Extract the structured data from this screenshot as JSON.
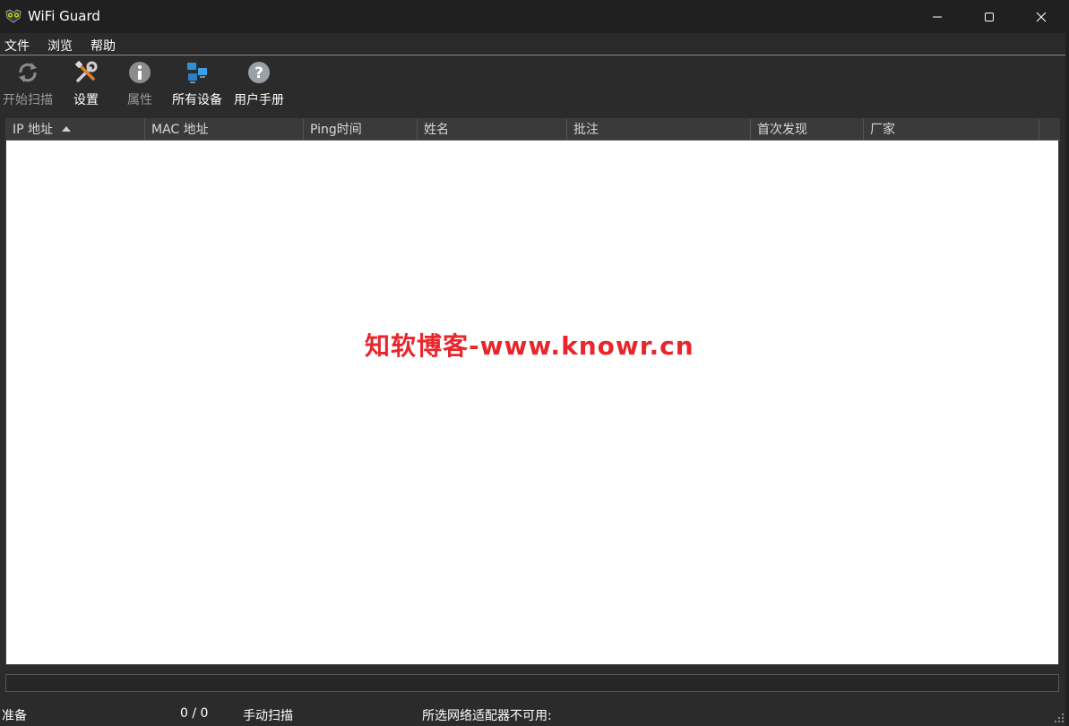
{
  "window": {
    "title": "WiFi Guard"
  },
  "menu": {
    "items": [
      {
        "label": "文件"
      },
      {
        "label": "浏览"
      },
      {
        "label": "帮助"
      }
    ]
  },
  "toolbar": {
    "items": [
      {
        "label": "开始扫描",
        "icon": "refresh-icon",
        "enabled": false
      },
      {
        "label": "设置",
        "icon": "tools-icon",
        "enabled": true
      },
      {
        "label": "属性",
        "icon": "info-icon",
        "enabled": false
      },
      {
        "label": "所有设备",
        "icon": "network-devices-icon",
        "enabled": true
      },
      {
        "label": "用户手册",
        "icon": "help-icon",
        "enabled": true
      }
    ]
  },
  "table": {
    "columns": [
      {
        "label": "IP 地址",
        "sorted": "ascending"
      },
      {
        "label": "MAC 地址"
      },
      {
        "label": "Ping时间"
      },
      {
        "label": "姓名"
      },
      {
        "label": "批注"
      },
      {
        "label": "首次发现"
      },
      {
        "label": "厂家"
      }
    ],
    "rows": []
  },
  "watermark": "知软博客-www.knowr.cn",
  "progress": {
    "value": 0
  },
  "statusbar": {
    "state": "准备",
    "count": "0 / 0",
    "mode": "手动扫描",
    "adapter": "所选网络适配器不可用:"
  },
  "colors": {
    "window_bg": "#2b2b2b",
    "titlebar_bg": "#202020",
    "table_bg": "#ffffff",
    "header_bg": "#3a3a3a",
    "watermark": "#e8262c"
  }
}
